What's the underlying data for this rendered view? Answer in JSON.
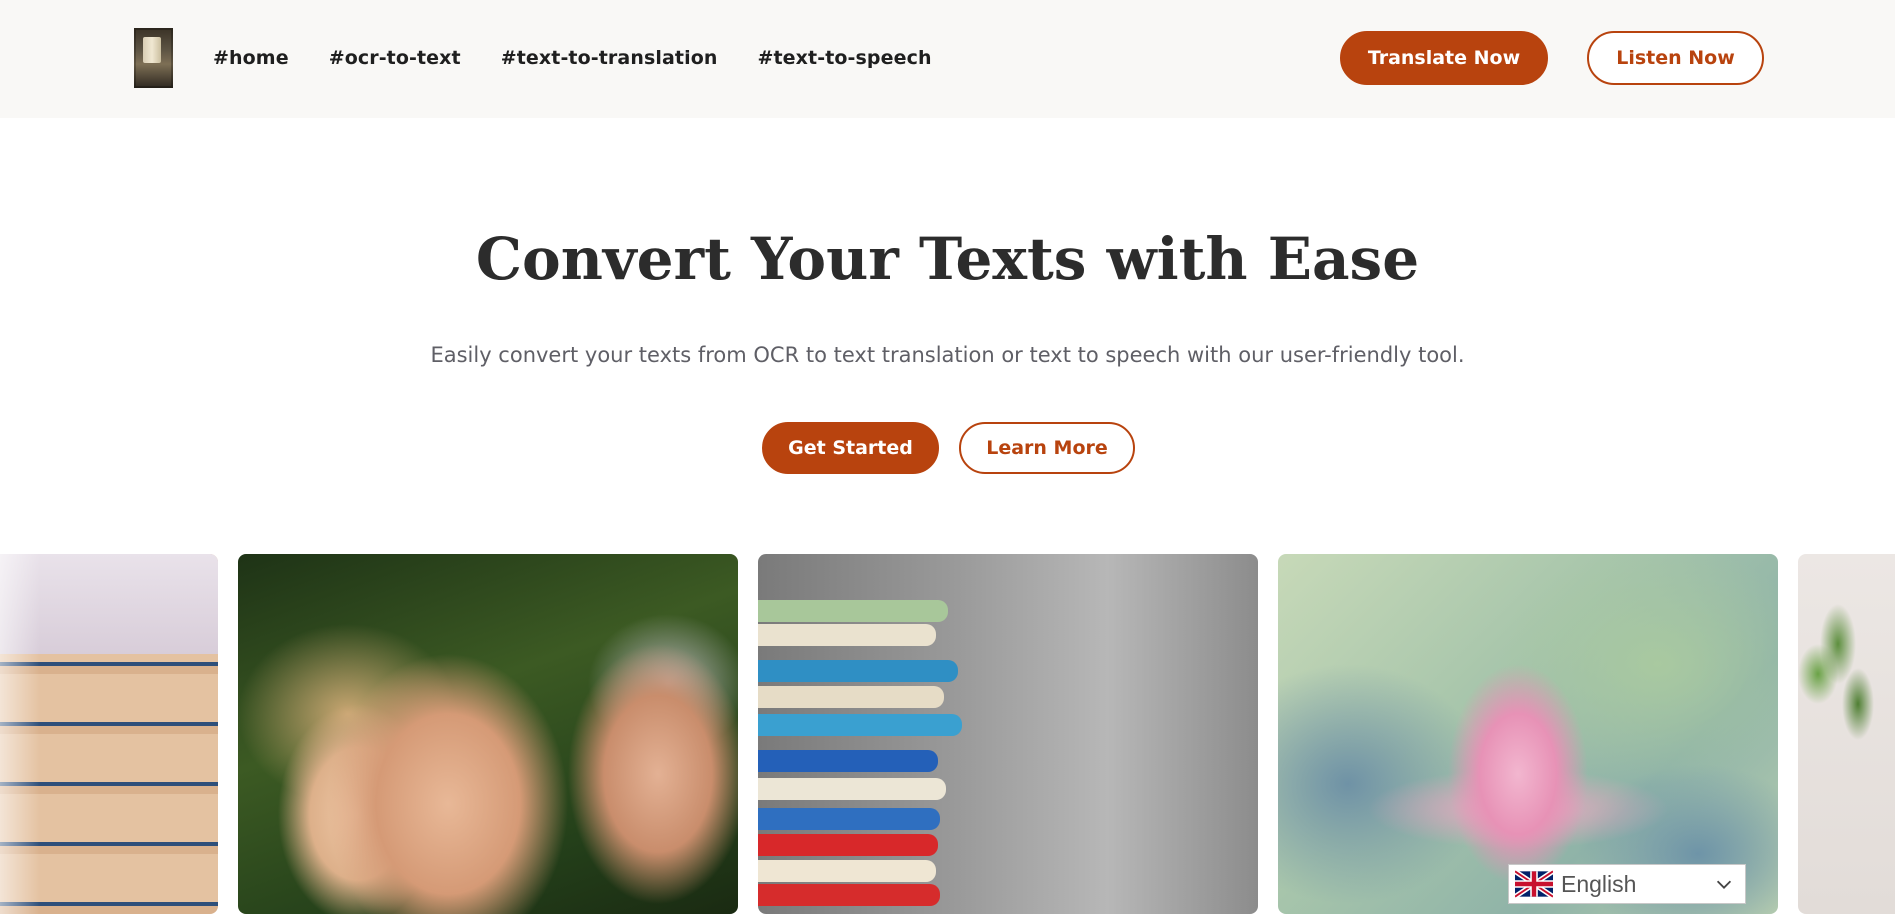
{
  "header": {
    "nav": [
      "#home",
      "#ocr-to-text",
      "#text-to-translation",
      "#text-to-speech"
    ],
    "translate_label": "Translate Now",
    "listen_label": "Listen Now"
  },
  "hero": {
    "title": "Convert Your Texts with Ease",
    "subtitle": "Easily convert your texts from OCR to text translation or text to speech with our user-friendly tool.",
    "primary_cta": "Get Started",
    "secondary_cta": "Learn More"
  },
  "language_selector": {
    "selected": "English",
    "flag_icon": "uk-flag-icon"
  },
  "colors": {
    "accent": "#b8430e",
    "header_bg": "#f9f8f6",
    "title": "#2c2c2c",
    "subtitle": "#5f5f66"
  }
}
